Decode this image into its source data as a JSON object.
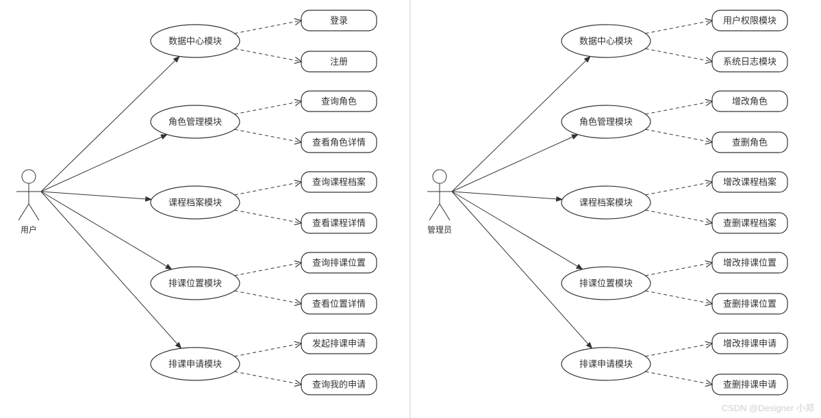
{
  "watermark": "CSDN @Designer 小郑",
  "left": {
    "actor": "用户",
    "modules": [
      {
        "name": "数据中心模块",
        "leaves": [
          "登录",
          "注册"
        ]
      },
      {
        "name": "角色管理模块",
        "leaves": [
          "查询角色",
          "查看角色详情"
        ]
      },
      {
        "name": "课程档案模块",
        "leaves": [
          "查询课程档案",
          "查看课程详情"
        ]
      },
      {
        "name": "排课位置模块",
        "leaves": [
          "查询排课位置",
          "查看位置详情"
        ]
      },
      {
        "name": "排课申请模块",
        "leaves": [
          "发起排课申请",
          "查询我的申请"
        ]
      }
    ]
  },
  "right": {
    "actor": "管理员",
    "modules": [
      {
        "name": "数据中心模块",
        "leaves": [
          "用户权限模块",
          "系统日志模块"
        ]
      },
      {
        "name": "角色管理模块",
        "leaves": [
          "增改角色",
          "查删角色"
        ]
      },
      {
        "name": "课程档案模块",
        "leaves": [
          "增改课程档案",
          "查删课程档案"
        ]
      },
      {
        "name": "排课位置模块",
        "leaves": [
          "增改排课位置",
          "查删排课位置"
        ]
      },
      {
        "name": "排课申请模块",
        "leaves": [
          "增改排课申请",
          "查删排课申请"
        ]
      }
    ]
  }
}
